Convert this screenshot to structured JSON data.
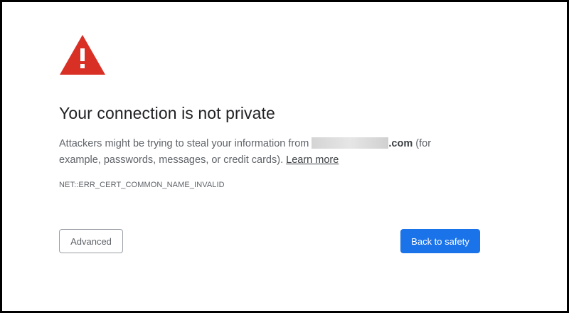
{
  "interstitial": {
    "heading": "Your connection is not private",
    "message_prefix": "Attackers might be trying to steal your information from ",
    "domain_suffix": ".com",
    "message_suffix": " (for example, passwords, messages, or credit cards). ",
    "learn_more": "Learn more",
    "error_code": "NET::ERR_CERT_COMMON_NAME_INVALID",
    "advanced_button": "Advanced",
    "back_button": "Back to safety",
    "icon": "warning-triangle-icon"
  },
  "colors": {
    "warning_red": "#d93025",
    "primary_blue": "#1a73e8",
    "heading_text": "#202124",
    "body_text": "#5f6368"
  }
}
